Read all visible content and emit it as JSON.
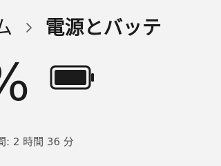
{
  "breadcrumb": {
    "parent_label": "ム",
    "separator_icon": "chevron-right-icon",
    "current_label": "電源とバッテ"
  },
  "battery": {
    "percent_text": "%",
    "icon": "battery-full-icon",
    "charge_level": 1.0,
    "time_remaining": "間: 2 時間 36 分"
  }
}
